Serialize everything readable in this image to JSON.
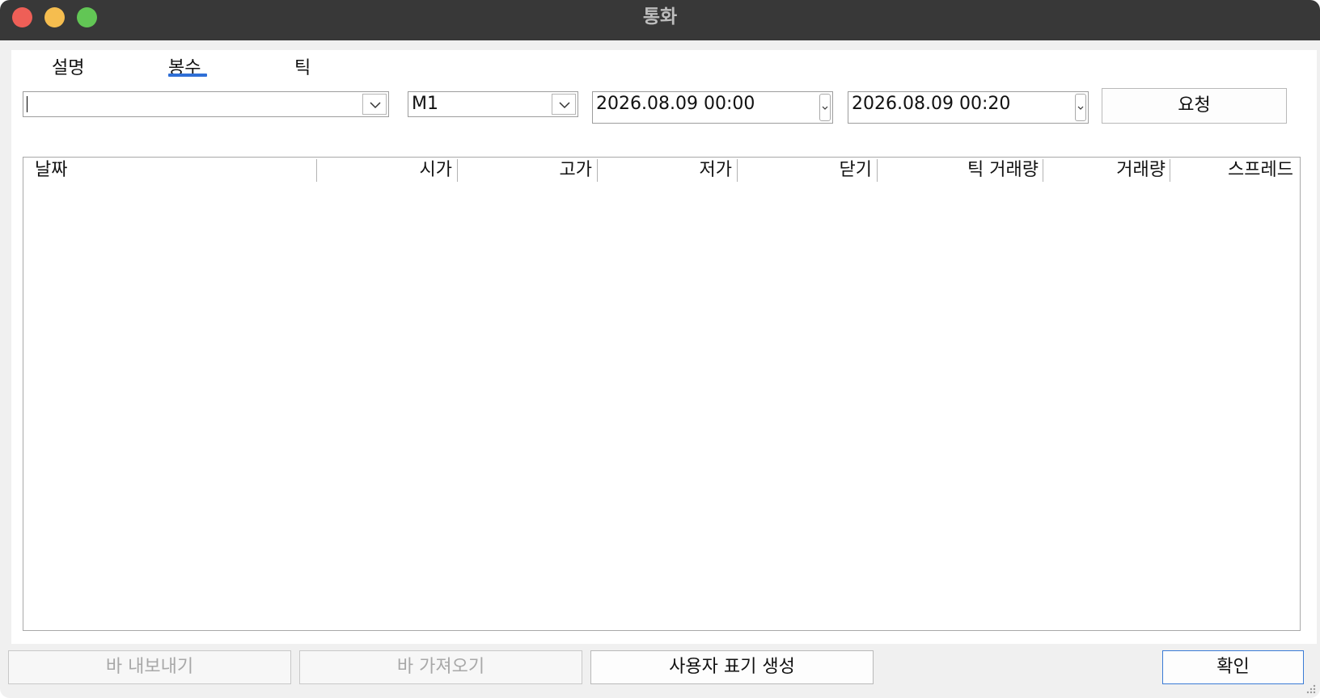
{
  "window": {
    "title": "통화"
  },
  "tabs": [
    {
      "label": "설명"
    },
    {
      "label": "봉수"
    },
    {
      "label": "틱"
    }
  ],
  "active_tab": "봉수",
  "toolbar": {
    "symbol_value": "",
    "timeframe_value": "M1",
    "date_from": "2026.08.09 00:00",
    "date_to": "2026.08.09 00:20",
    "request_label": "요청"
  },
  "table": {
    "columns": [
      "날짜",
      "시가",
      "고가",
      "저가",
      "닫기",
      "틱 거래량",
      "거래량",
      "스프레드"
    ],
    "rows": []
  },
  "footer": {
    "export_label": "바 내보내기",
    "import_label": "바 가져오기",
    "create_custom_label": "사용자 표기 생성",
    "ok_label": "확인"
  },
  "colors": {
    "titlebar": "#383838",
    "close": "#ee5f57",
    "minimize": "#f5bd4f",
    "maximize": "#62c655",
    "tab_accent": "#2f6fd6",
    "default_button_border": "#3a7bd5"
  },
  "icons": {
    "combo_arrow": "chevron-down-icon",
    "datetime_arrow": "chevron-down-icon"
  }
}
